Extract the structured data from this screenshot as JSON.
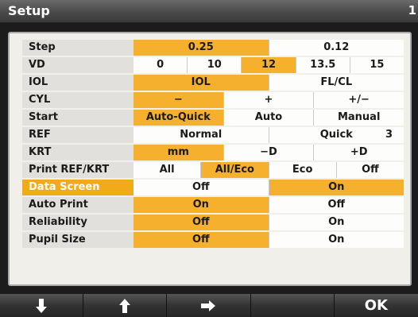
{
  "title": "Setup",
  "page_number": "1",
  "settings": [
    {
      "label": "Step",
      "highlight": false,
      "options": [
        {
          "text": "0.25",
          "selected": true
        },
        {
          "text": "0.12",
          "selected": false
        }
      ]
    },
    {
      "label": "VD",
      "highlight": false,
      "options": [
        {
          "text": "0",
          "selected": false
        },
        {
          "text": "10",
          "selected": false
        },
        {
          "text": "12",
          "selected": true
        },
        {
          "text": "13.5",
          "selected": false
        },
        {
          "text": "15",
          "selected": false
        }
      ]
    },
    {
      "label": "IOL",
      "highlight": false,
      "options": [
        {
          "text": "IOL",
          "selected": true
        },
        {
          "text": "FL/CL",
          "selected": false
        }
      ]
    },
    {
      "label": "CYL",
      "highlight": false,
      "options": [
        {
          "text": "−",
          "selected": true
        },
        {
          "text": "+",
          "selected": false
        },
        {
          "text": "+/−",
          "selected": false
        }
      ]
    },
    {
      "label": "Start",
      "highlight": false,
      "options": [
        {
          "text": "Auto-Quick",
          "selected": true
        },
        {
          "text": "Auto",
          "selected": false
        },
        {
          "text": "Manual",
          "selected": false
        }
      ]
    },
    {
      "label": "REF",
      "highlight": false,
      "options": [
        {
          "text": "Normal",
          "selected": false
        },
        {
          "text": "Quick",
          "extra": "3",
          "selected": false
        }
      ]
    },
    {
      "label": "KRT",
      "highlight": false,
      "options": [
        {
          "text": "mm",
          "selected": true
        },
        {
          "text": "−D",
          "selected": false
        },
        {
          "text": "+D",
          "selected": false
        }
      ]
    },
    {
      "label": "Print REF/KRT",
      "highlight": false,
      "options": [
        {
          "text": "All",
          "selected": false
        },
        {
          "text": "All/Eco",
          "selected": true
        },
        {
          "text": "Eco",
          "selected": false
        },
        {
          "text": "Off",
          "selected": false
        }
      ]
    },
    {
      "label": "Data Screen",
      "highlight": true,
      "options": [
        {
          "text": "Off",
          "selected": false
        },
        {
          "text": "On",
          "selected": true
        }
      ]
    },
    {
      "label": "Auto Print",
      "highlight": false,
      "options": [
        {
          "text": "On",
          "selected": true
        },
        {
          "text": "Off",
          "selected": false
        }
      ]
    },
    {
      "label": "Reliability",
      "highlight": false,
      "options": [
        {
          "text": "Off",
          "selected": true
        },
        {
          "text": "On",
          "selected": false
        }
      ]
    },
    {
      "label": "Pupil Size",
      "highlight": false,
      "options": [
        {
          "text": "Off",
          "selected": true
        },
        {
          "text": "On",
          "selected": false
        }
      ]
    }
  ],
  "softkeys": [
    {
      "name": "down-arrow-softkey",
      "icon": "arrow-down-icon",
      "label": ""
    },
    {
      "name": "up-arrow-softkey",
      "icon": "arrow-up-icon",
      "label": ""
    },
    {
      "name": "right-arrow-softkey",
      "icon": "arrow-right-icon",
      "label": ""
    },
    {
      "name": "blank-softkey",
      "icon": "",
      "label": ""
    },
    {
      "name": "ok-softkey",
      "icon": "",
      "label": "OK"
    }
  ],
  "colors": {
    "selected": "#f5b12e",
    "row_highlight": "#f0aa1a",
    "panel_bg": "#f0efea"
  }
}
